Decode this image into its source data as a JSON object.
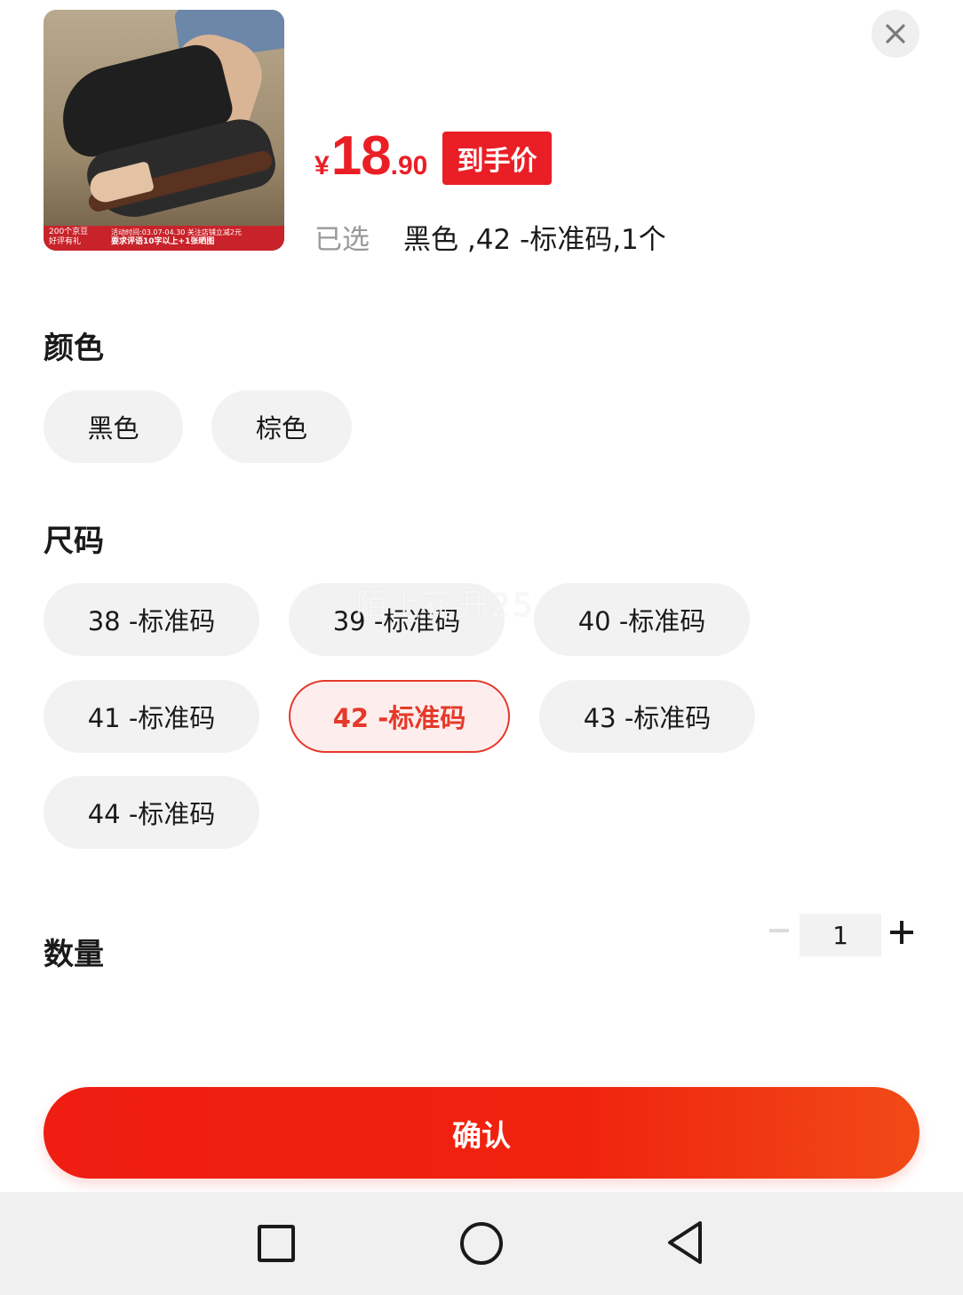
{
  "product": {
    "image_banner": {
      "line1_left": "200个京豆",
      "line2_left": "好评有礼",
      "line1_right": "活动时间:03.07-04.30  关注店铺立减2元",
      "line2_right": "要求评语10字以上+1张晒图"
    },
    "price": {
      "currency": "¥",
      "integer": "18",
      "decimal": ".90",
      "tag": "到手价"
    },
    "selected": {
      "label": "已选",
      "value": "黑色 ,42 -标准码,1个"
    }
  },
  "color_section": {
    "title": "颜色",
    "options": [
      "黑色",
      "棕色"
    ]
  },
  "size_section": {
    "title": "尺码",
    "options": [
      "38 -标准码",
      "39 -标准码",
      "40 -标准码",
      "41 -标准码",
      "42 -标准码",
      "43 -标准码",
      "44 -标准码"
    ],
    "selected": "42 -标准码"
  },
  "watermark": "陌上花开25",
  "quantity": {
    "title": "数量",
    "value": "1"
  },
  "confirm_label": "确认",
  "colors": {
    "accent": "#ea1f26",
    "chip_bg": "#f2f2f2",
    "selected_chip_bg": "#fdeeed"
  },
  "icons": {
    "close": "close-icon",
    "nav_recent": "square-icon",
    "nav_home": "circle-icon",
    "nav_back": "triangle-back-icon"
  }
}
